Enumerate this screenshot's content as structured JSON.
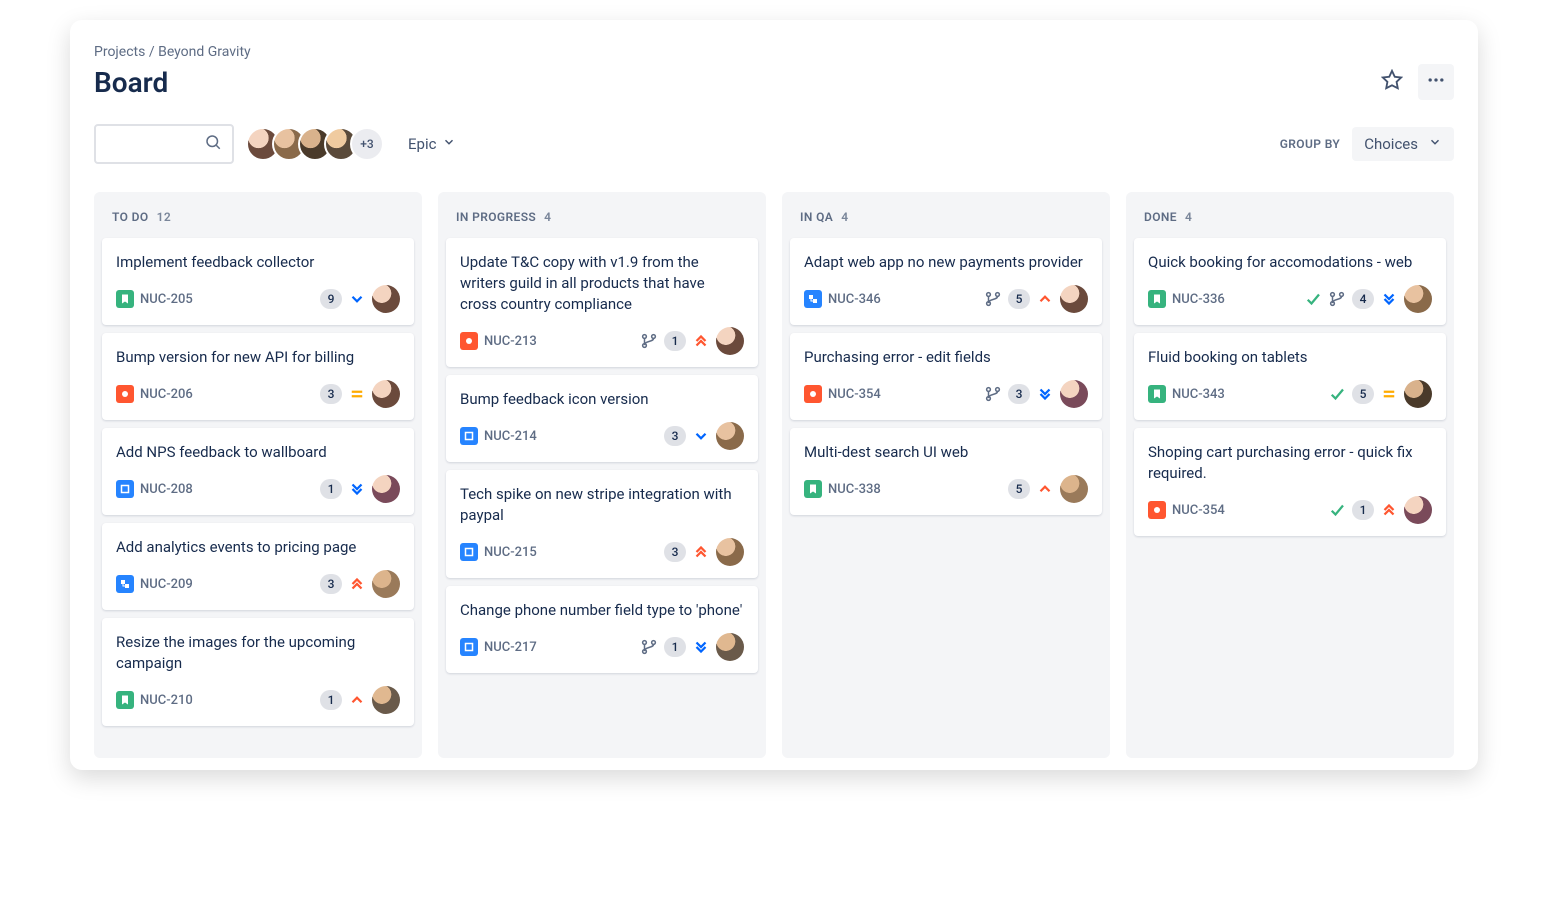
{
  "breadcrumb": {
    "projects": "Projects",
    "sep": "/",
    "name": "Beyond Gravity"
  },
  "title": "Board",
  "avatars_more": "+3",
  "epic_filter": "Epic",
  "group_by_label": "GROUP BY",
  "group_by_value": "Choices",
  "issue_types": {
    "story": {
      "bg": "#36B37E"
    },
    "bug": {
      "bg": "#FF5630"
    },
    "task": {
      "bg": "#2684FF"
    },
    "subtask": {
      "bg": "#2684FF"
    }
  },
  "priorities": {
    "lowest": {
      "color": "#0065FF",
      "shape": "chevdown2"
    },
    "low": {
      "color": "#0065FF",
      "shape": "chevdown1"
    },
    "medium": {
      "color": "#FFAB00",
      "shape": "equals"
    },
    "high": {
      "color": "#FF5630",
      "shape": "chevup1"
    },
    "highest": {
      "color": "#FF5630",
      "shape": "chevup2"
    }
  },
  "columns": [
    {
      "name": "TO DO",
      "count": "12",
      "cards": [
        {
          "title": "Implement feedback collector",
          "type": "story",
          "key": "NUC-205",
          "points": "9",
          "priority": "low",
          "avatar": "av1"
        },
        {
          "title": "Bump version for new API for billing",
          "type": "bug",
          "key": "NUC-206",
          "points": "3",
          "priority": "medium",
          "avatar": "av1"
        },
        {
          "title": "Add NPS feedback to wallboard",
          "type": "task",
          "key": "NUC-208",
          "points": "1",
          "priority": "lowest",
          "avatar": "av5"
        },
        {
          "title": "Add analytics events to pricing page",
          "type": "subtask",
          "key": "NUC-209",
          "points": "3",
          "priority": "highest",
          "avatar": "av7"
        },
        {
          "title": "Resize the images for the upcoming campaign",
          "type": "story",
          "key": "NUC-210",
          "points": "1",
          "priority": "high",
          "avatar": "av6"
        }
      ]
    },
    {
      "name": "IN PROGRESS",
      "count": "4",
      "cards": [
        {
          "title": "Update T&C copy with v1.9 from the writers guild in all products that have cross country compliance",
          "type": "bug",
          "key": "NUC-213",
          "branch": true,
          "points": "1",
          "priority": "highest",
          "avatar": "av1"
        },
        {
          "title": "Bump feedback icon version",
          "type": "task",
          "key": "NUC-214",
          "points": "3",
          "priority": "low",
          "avatar": "av2"
        },
        {
          "title": "Tech spike on new stripe integration with paypal",
          "type": "task",
          "key": "NUC-215",
          "points": "3",
          "priority": "highest",
          "avatar": "av2"
        },
        {
          "title": "Change phone number field type to 'phone'",
          "type": "task",
          "key": "NUC-217",
          "branch": true,
          "points": "1",
          "priority": "lowest",
          "avatar": "av6"
        }
      ]
    },
    {
      "name": "IN QA",
      "count": "4",
      "cards": [
        {
          "title": "Adapt web app no new payments provider",
          "type": "subtask",
          "key": "NUC-346",
          "branch": true,
          "points": "5",
          "priority": "high",
          "avatar": "av1"
        },
        {
          "title": "Purchasing error - edit fields",
          "type": "bug",
          "key": "NUC-354",
          "branch": true,
          "points": "3",
          "priority": "lowest",
          "avatar": "av5"
        },
        {
          "title": "Multi-dest search UI web",
          "type": "story",
          "key": "NUC-338",
          "points": "5",
          "priority": "high",
          "avatar": "av7"
        }
      ]
    },
    {
      "name": "DONE",
      "count": "4",
      "cards": [
        {
          "title": "Quick booking for accomodations - web",
          "type": "story",
          "key": "NUC-336",
          "done": true,
          "branch": true,
          "points": "4",
          "priority": "lowest",
          "avatar": "av2"
        },
        {
          "title": "Fluid booking on tablets",
          "type": "story",
          "key": "NUC-343",
          "done": true,
          "points": "5",
          "priority": "medium",
          "avatar": "av3"
        },
        {
          "title": "Shoping cart purchasing error - quick fix required.",
          "type": "bug",
          "key": "NUC-354",
          "done": true,
          "points": "1",
          "priority": "highest",
          "avatar": "av5"
        }
      ]
    }
  ]
}
